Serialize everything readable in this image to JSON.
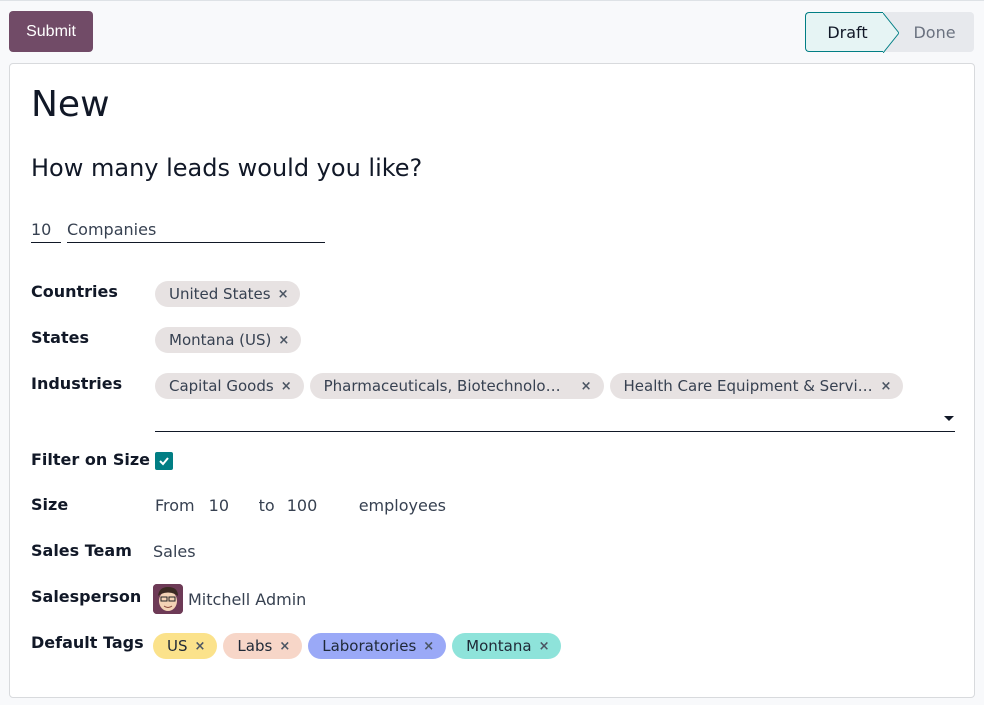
{
  "toolbar": {
    "submit_label": "Submit"
  },
  "statusbar": {
    "stages": [
      {
        "label": "Draft",
        "active": true
      },
      {
        "label": "Done",
        "active": false
      }
    ]
  },
  "form": {
    "title": "New",
    "subtitle": "How many leads would you like?",
    "lead_count": "10",
    "lead_type": "Companies",
    "countries": {
      "label": "Countries",
      "tags": [
        "United States"
      ]
    },
    "states": {
      "label": "States",
      "tags": [
        "Montana (US)"
      ]
    },
    "industries": {
      "label": "Industries",
      "tags": [
        "Capital Goods",
        "Pharmaceuticals, Biotechnolog…",
        "Health Care Equipment & Servic…"
      ]
    },
    "filter_on_size": {
      "label": "Filter on Size",
      "checked": true
    },
    "size": {
      "label": "Size",
      "from_label": "From",
      "from": "10",
      "to_label": "to",
      "to": "100",
      "unit": "employees"
    },
    "sales_team": {
      "label": "Sales Team",
      "value": "Sales"
    },
    "salesperson": {
      "label": "Salesperson",
      "value": "Mitchell Admin"
    },
    "default_tags": {
      "label": "Default Tags",
      "tags": [
        {
          "name": "US",
          "color": "#fbe28b"
        },
        {
          "name": "Labs",
          "color": "#f7d6c8"
        },
        {
          "name": "Laboratories",
          "color": "#9aa9f7"
        },
        {
          "name": "Montana",
          "color": "#8ee3da"
        }
      ]
    }
  },
  "icons": {
    "remove": "×",
    "check": "check-icon",
    "dropdown": "caret-down-icon"
  }
}
